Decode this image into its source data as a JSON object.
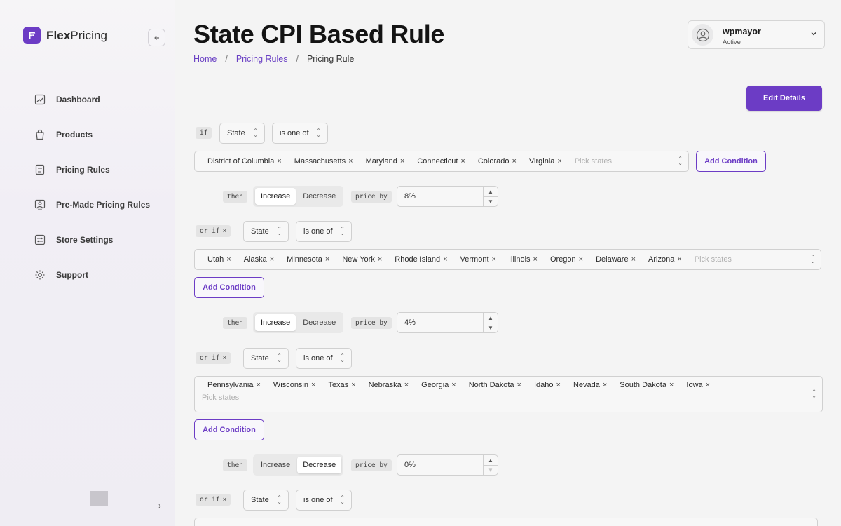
{
  "app": {
    "name_bold": "Flex",
    "name_rest": "Pricing"
  },
  "sidebar": {
    "items": [
      {
        "label": "Dashboard",
        "icon": "chart-icon"
      },
      {
        "label": "Products",
        "icon": "bag-icon"
      },
      {
        "label": "Pricing Rules",
        "icon": "document-icon"
      },
      {
        "label": "Pre-Made Pricing Rules",
        "icon": "user-card-icon"
      },
      {
        "label": "Store Settings",
        "icon": "sliders-icon"
      },
      {
        "label": "Support",
        "icon": "gear-icon"
      }
    ]
  },
  "header": {
    "title": "State CPI Based Rule",
    "breadcrumb": [
      "Home",
      "Pricing Rules",
      "Pricing Rule"
    ],
    "separator": "/",
    "user": {
      "name": "wpmayor",
      "status": "Active"
    },
    "edit_label": "Edit Details"
  },
  "labels": {
    "if": "if",
    "or_if": "or if",
    "then": "then",
    "price_by": "price by",
    "field": "State",
    "operator": "is one of",
    "pick_placeholder": "Pick states",
    "add_condition": "Add Condition",
    "increase": "Increase",
    "decrease": "Decrease",
    "remove": "×"
  },
  "rules": [
    {
      "states": [
        "District of Columbia",
        "Massachusetts",
        "Maryland",
        "Connecticut",
        "Colorado",
        "Virginia"
      ],
      "direction": "Increase",
      "value": "8%"
    },
    {
      "states": [
        "Utah",
        "Alaska",
        "Minnesota",
        "New York",
        "Rhode Island",
        "Vermont",
        "Illinois",
        "Oregon",
        "Delaware",
        "Arizona"
      ],
      "direction": "Increase",
      "value": "4%"
    },
    {
      "states": [
        "Pennsylvania",
        "Wisconsin",
        "Texas",
        "Nebraska",
        "Georgia",
        "North Dakota",
        "Idaho",
        "Nevada",
        "South Dakota",
        "Iowa"
      ],
      "direction": "Decrease",
      "value": "0%"
    }
  ],
  "colors": {
    "accent": "#6c3cc5"
  }
}
